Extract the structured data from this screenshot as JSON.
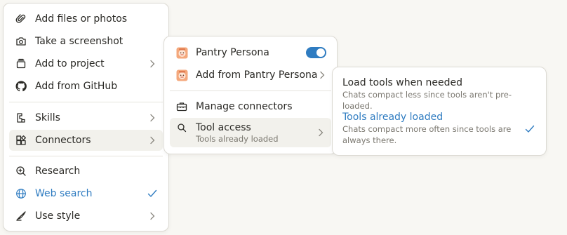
{
  "colors": {
    "accent": "#2f7cc1",
    "background": "#f8f7f3",
    "menu_bg": "#ffffff",
    "highlight": "#f2f1ec"
  },
  "main_menu": {
    "items": [
      {
        "label": "Add files or photos",
        "icon": "paperclip-icon"
      },
      {
        "label": "Take a screenshot",
        "icon": "camera-icon"
      },
      {
        "label": "Add to project",
        "icon": "project-icon",
        "submenu": true
      },
      {
        "label": "Add from GitHub",
        "icon": "github-icon"
      },
      {
        "label": "Skills",
        "icon": "skills-icon",
        "submenu": true
      },
      {
        "label": "Connectors",
        "icon": "connectors-icon",
        "submenu": true,
        "highlighted": true
      },
      {
        "label": "Research",
        "icon": "research-icon"
      },
      {
        "label": "Web search",
        "icon": "globe-icon",
        "checked": true
      },
      {
        "label": "Use style",
        "icon": "style-icon",
        "submenu": true
      }
    ]
  },
  "connectors_menu": {
    "items": [
      {
        "label": "Pantry Persona",
        "icon": "pantry-persona-icon",
        "toggle_on": true
      },
      {
        "label": "Add from Pantry Persona",
        "icon": "pantry-persona-icon",
        "submenu": true
      },
      {
        "label": "Manage connectors",
        "icon": "toolbox-icon"
      },
      {
        "label": "Tool access",
        "sublabel": "Tools already loaded",
        "icon": "search-icon",
        "submenu": true,
        "highlighted": true
      }
    ]
  },
  "tool_access_menu": {
    "options": [
      {
        "title": "Load tools when needed",
        "description": "Chats compact less since tools aren't pre-loaded.",
        "selected": false
      },
      {
        "title": "Tools already loaded",
        "description_line1": "Chats compact more often since tools are",
        "description_line2": "always there.",
        "selected": true
      }
    ]
  }
}
